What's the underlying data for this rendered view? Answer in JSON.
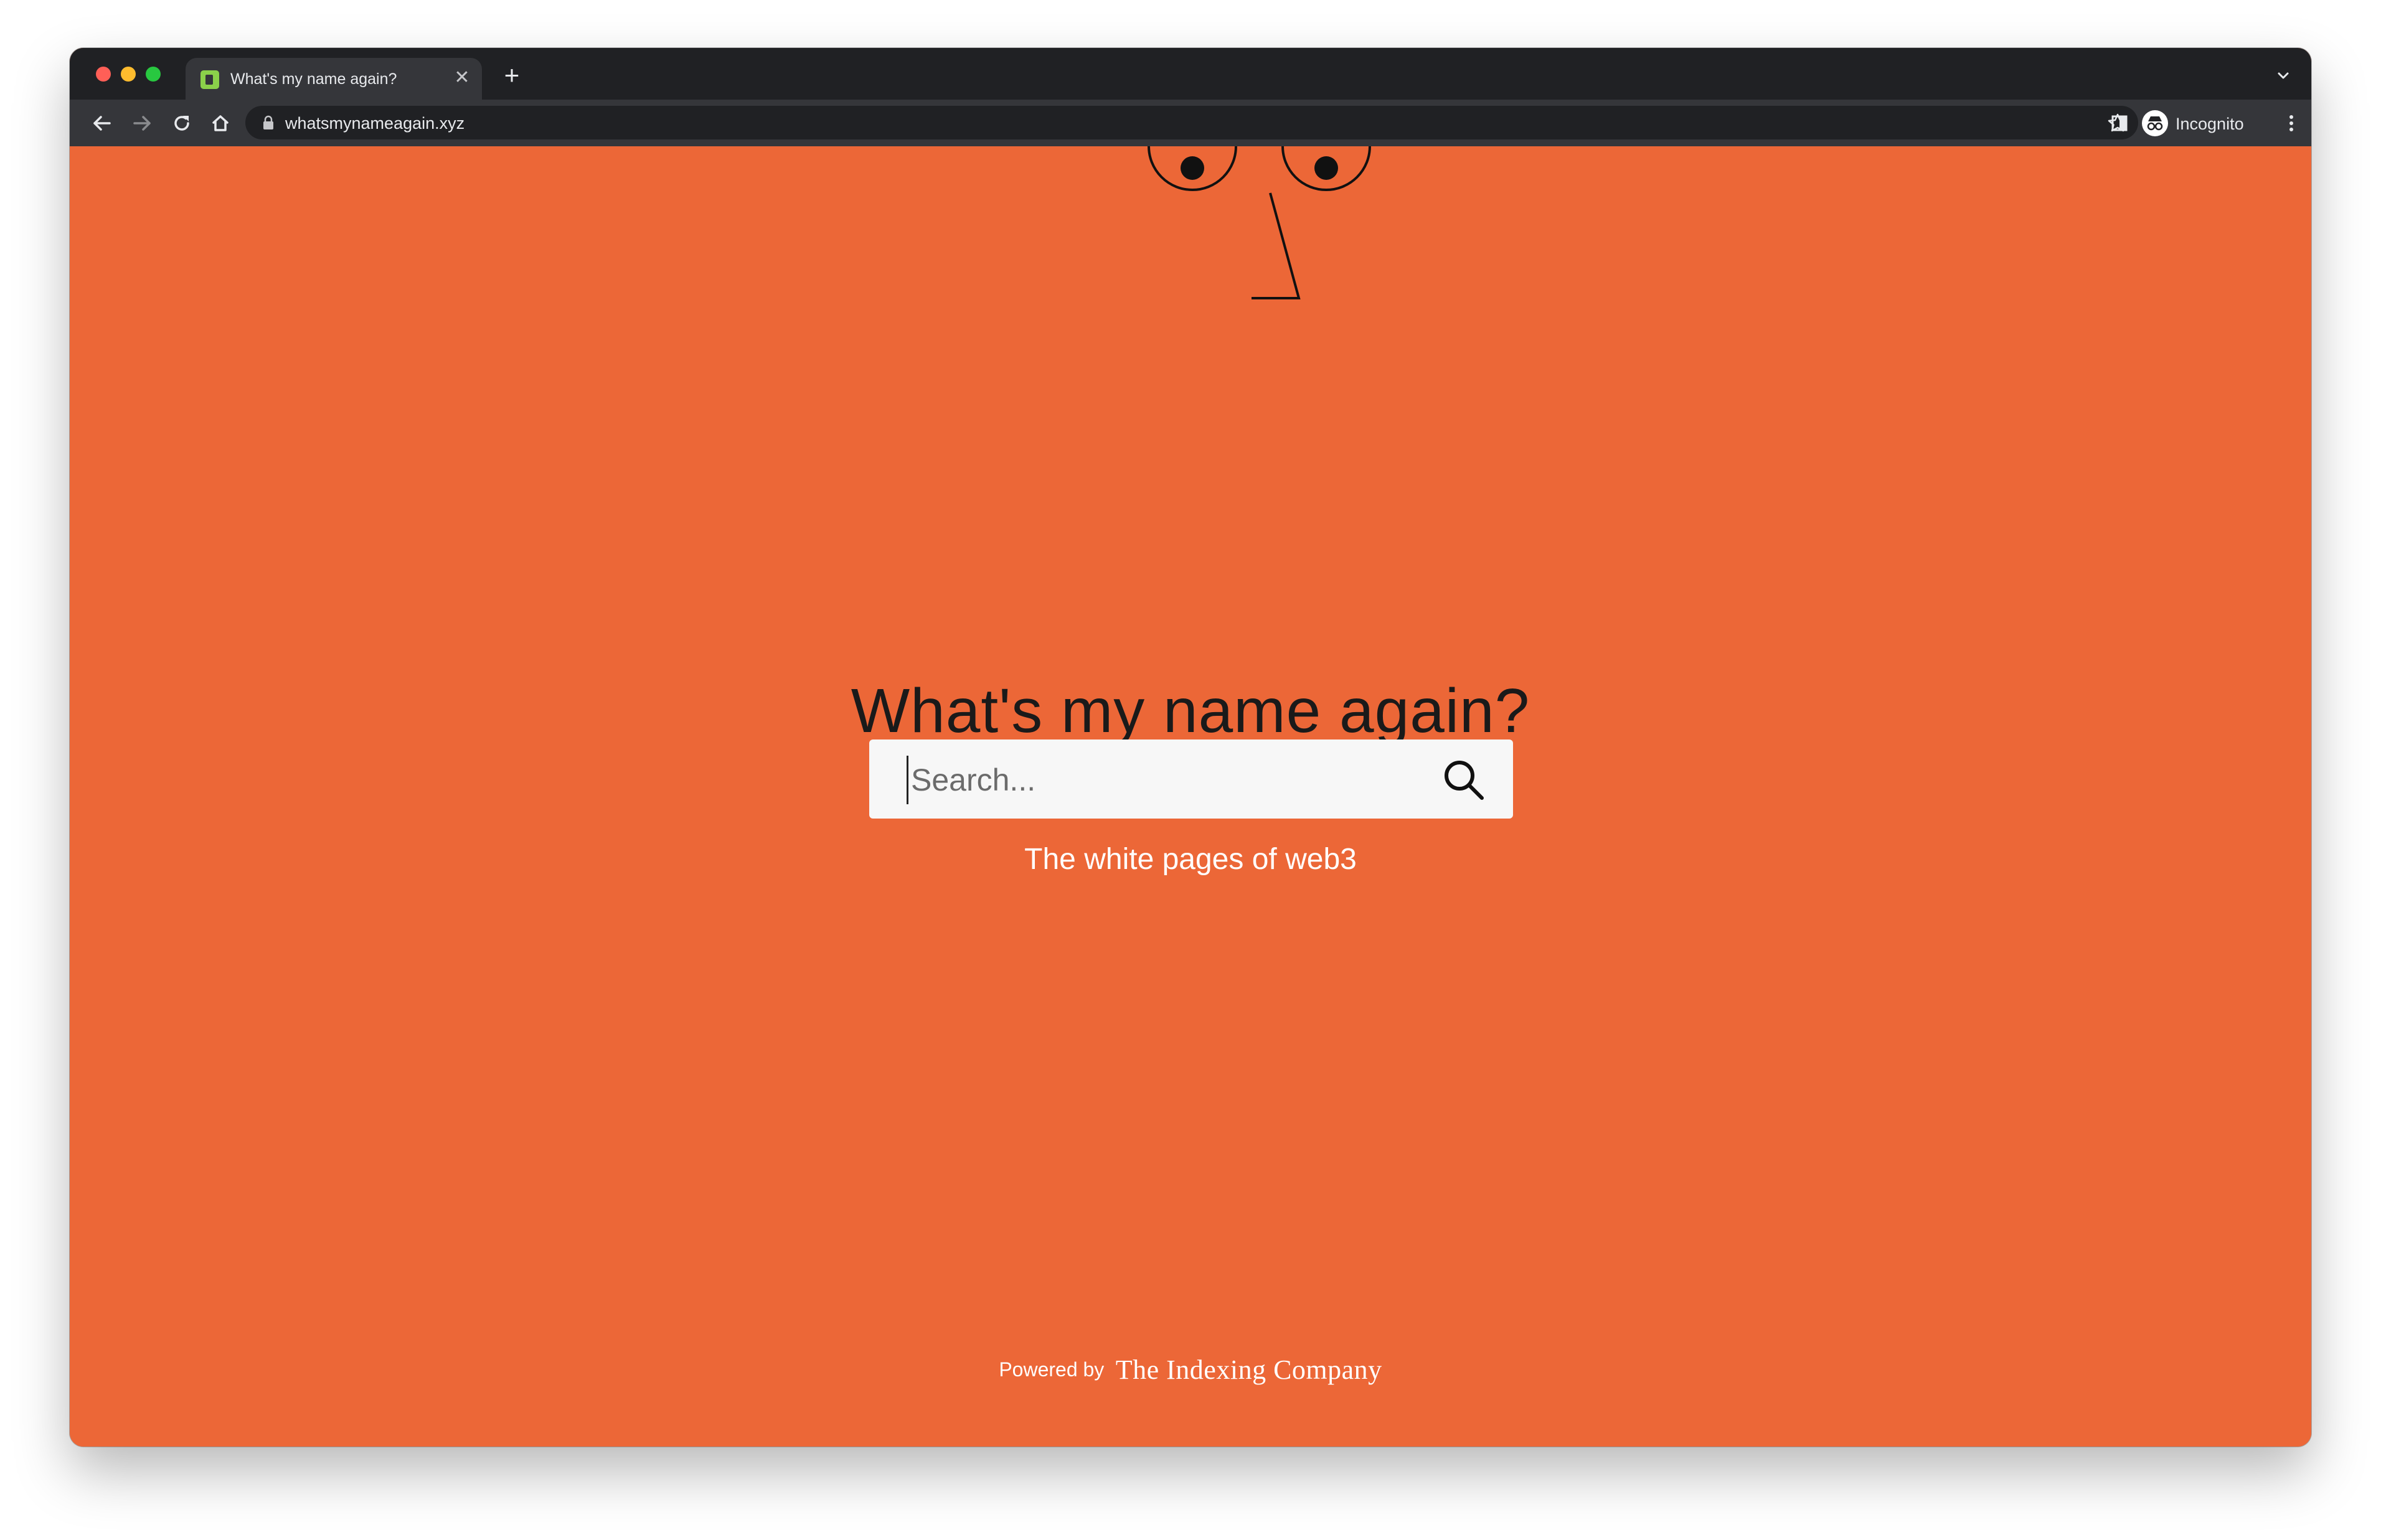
{
  "browser": {
    "tab_title": "What's my name again?",
    "url": "whatsmynameagain.xyz",
    "profile_label": "Incognito"
  },
  "page": {
    "headline": "What's my name again?",
    "search": {
      "placeholder": "Search...",
      "value": ""
    },
    "tagline": "The white pages of web3",
    "footer": {
      "powered_by": "Powered by",
      "brand": "The Indexing Company"
    }
  },
  "colors": {
    "background": "#ec6737",
    "chrome_dark": "#202124",
    "toolbar": "#35363a",
    "search_box": "#f7f7f7"
  }
}
